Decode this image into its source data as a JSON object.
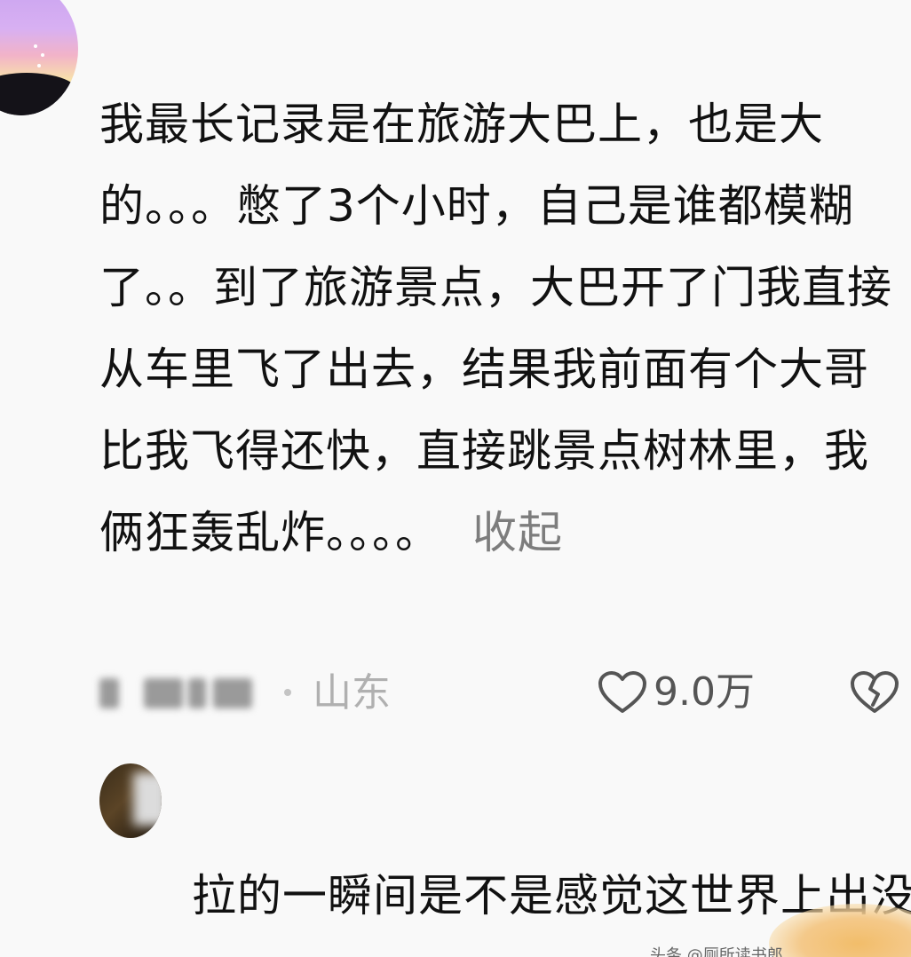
{
  "first_comment": {
    "text": "我最长记录是在旅游大巴上，也是大的。。。憋了3个小时，自己是谁都模糊了。。到了旅游景点，大巴开了门我直接从车里飞了出去，结果我前面有个大哥比我飞得还快，直接跳景点树林里，我俩狂轰乱炸。。。。",
    "collapse_label": "收起",
    "location": "山东",
    "like_count": "9.0万",
    "icons": {
      "like": "heart-outline-icon",
      "dislike": "broken-heart-icon"
    }
  },
  "second_comment": {
    "text": "拉的一瞬间是不是感觉这世界上出没啥大事"
  },
  "watermark": {
    "text": "头条 @厕所读书郎"
  }
}
